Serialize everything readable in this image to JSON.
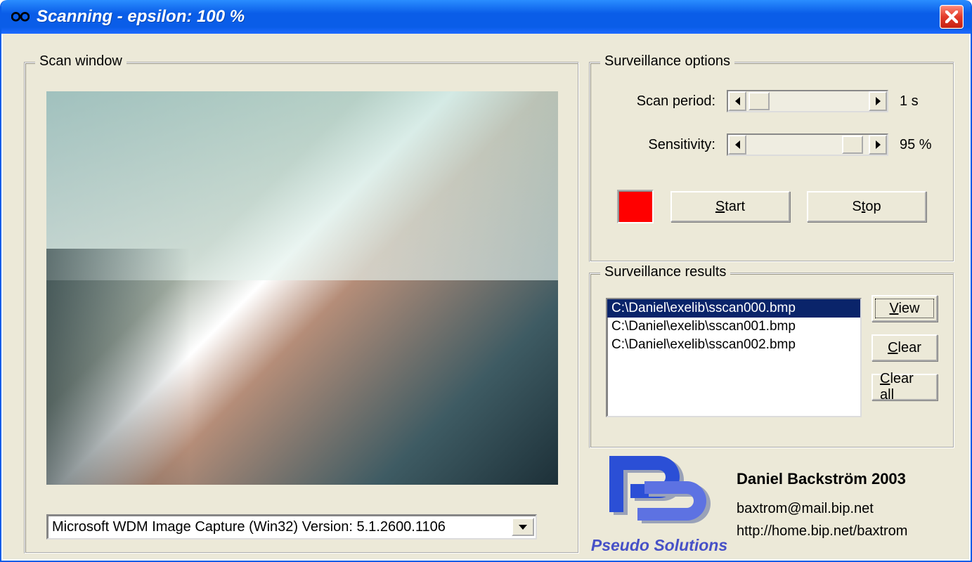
{
  "window": {
    "title": "Scanning - epsilon: 100 %"
  },
  "scan_window": {
    "legend": "Scan window",
    "device_dropdown": "Microsoft WDM Image Capture (Win32) Version:  5.1.2600.1106"
  },
  "surv_options": {
    "legend": "Surveillance options",
    "scan_period_label": "Scan period:",
    "scan_period_value": "1 s",
    "scan_period_pos_pct": 2,
    "sensitivity_label": "Sensitivity:",
    "sensitivity_value": "95 %",
    "sensitivity_pos_pct": 78,
    "status_color": "#ff0000",
    "start_label": "Start",
    "stop_label": "Stop"
  },
  "surv_results": {
    "legend": "Surveillance results",
    "items": [
      "C:\\Daniel\\exelib\\sscan000.bmp",
      "C:\\Daniel\\exelib\\sscan001.bmp",
      "C:\\Daniel\\exelib\\sscan002.bmp"
    ],
    "selected_index": 0,
    "view_label": "View",
    "clear_label": "Clear",
    "clear_all_label": "Clear all"
  },
  "footer": {
    "brand": "Pseudo Solutions",
    "author": "Daniel Backström 2003",
    "email": "baxtrom@mail.bip.net",
    "url": "http://home.bip.net/baxtrom"
  }
}
